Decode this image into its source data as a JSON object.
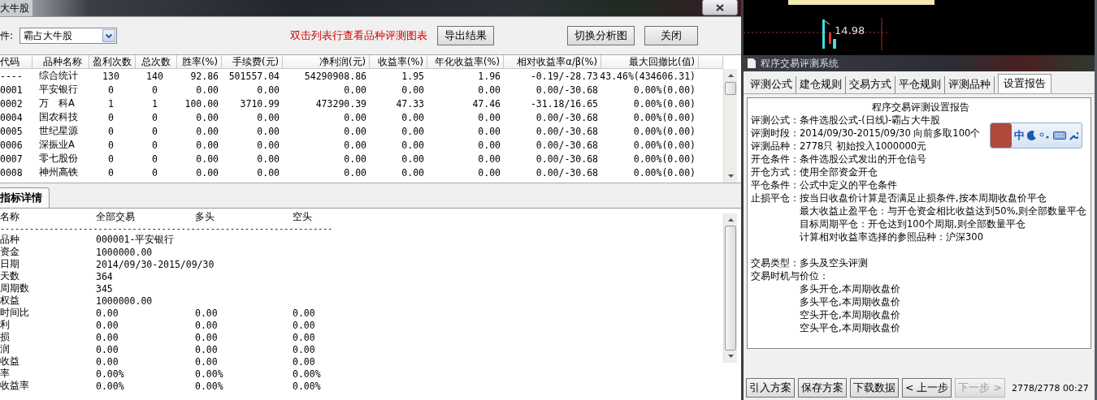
{
  "main_window": {
    "title": "大牛股",
    "condition": {
      "label": "件:",
      "value": "霸占大牛股"
    },
    "hint": "双击列表行查看品种评测图表",
    "export_button": "导出结果",
    "switch_button": "切换分析图",
    "close_button": "关闭",
    "table": {
      "columns": [
        "代码",
        "品种名称",
        "盈利次数",
        "总次数",
        "胜率(%)",
        "手续费(元)",
        "净利润(元)",
        "收益率(%)",
        "年化收益率(%)",
        "相对收益率α/β(%)",
        "最大回撤比(值)"
      ],
      "rows": [
        [
          "----",
          "综合统计",
          "130",
          "140",
          "92.86",
          "501557.04",
          "54290908.86",
          "1.95",
          "1.96",
          "-0.19/-28.73",
          "43.46%(434606.31)"
        ],
        [
          "0001",
          "平安银行",
          "0",
          "0",
          "0.00",
          "0.00",
          "0.00",
          "0.00",
          "0.00",
          "0.00/-30.68",
          "0.00%(0.00)"
        ],
        [
          "0002",
          "万　科A",
          "1",
          "1",
          "100.00",
          "3710.99",
          "473290.39",
          "47.33",
          "47.46",
          "-31.18/16.65",
          "0.00%(0.00)"
        ],
        [
          "0004",
          "国农科技",
          "0",
          "0",
          "0.00",
          "0.00",
          "0.00",
          "0.00",
          "0.00",
          "0.00/-30.68",
          "0.00%(0.00)"
        ],
        [
          "0005",
          "世纪星源",
          "0",
          "0",
          "0.00",
          "0.00",
          "0.00",
          "0.00",
          "0.00",
          "0.00/-30.68",
          "0.00%(0.00)"
        ],
        [
          "0006",
          "深振业A",
          "0",
          "0",
          "0.00",
          "0.00",
          "0.00",
          "0.00",
          "0.00",
          "0.00/-30.68",
          "0.00%(0.00)"
        ],
        [
          "0007",
          "零七股份",
          "0",
          "0",
          "0.00",
          "0.00",
          "0.00",
          "0.00",
          "0.00",
          "0.00/-30.68",
          "0.00%(0.00)"
        ],
        [
          "0008",
          "神州高铁",
          "0",
          "0",
          "0.00",
          "0.00",
          "0.00",
          "0.00",
          "0.00",
          "0.00/-30.68",
          "0.00%(0.00)"
        ]
      ]
    },
    "details": {
      "tabs": [
        {
          "label": "指标详情",
          "selected": true
        }
      ],
      "columns": [
        "名称",
        "全部交易",
        "多头",
        "空头"
      ],
      "separator": "--------------------------------------------------------------------",
      "rows": [
        [
          "品种",
          "000001-平安银行"
        ],
        [
          "资金",
          "1000000.00"
        ],
        [
          "日期",
          "2014/09/30-2015/09/30"
        ],
        [
          "天数",
          "364"
        ],
        [
          "周期数",
          "345"
        ],
        [
          "权益",
          "1000000.00"
        ],
        [
          "时间比",
          "0.00",
          "0.00",
          "0.00"
        ],
        [
          "利",
          "0.00",
          "0.00",
          "0.00"
        ],
        [
          "损",
          "0.00",
          "0.00",
          "0.00"
        ],
        [
          "润",
          "0.00",
          "0.00",
          "0.00"
        ],
        [
          "收益",
          "0.00",
          "0.00",
          "0.00"
        ],
        [
          "率",
          "0.00%",
          "0.00%",
          "0.00%"
        ],
        [
          "收益率",
          "0.00%",
          "0.00%",
          "0.00%"
        ]
      ]
    }
  },
  "chart_backdrop": {
    "price_label": "14.98"
  },
  "report_window": {
    "title": "程序交易评测系统",
    "tabs": [
      {
        "label": "评测公式",
        "selected": false
      },
      {
        "label": "建仓规则",
        "selected": false
      },
      {
        "label": "交易方式",
        "selected": false
      },
      {
        "label": "平仓规则",
        "selected": false
      },
      {
        "label": "评测品种",
        "selected": false
      },
      {
        "label": "设置报告",
        "selected": true
      }
    ],
    "heading": "程序交易评测设置报告",
    "sections": [
      [
        {
          "kind": "field",
          "label": "评测公式：",
          "text": "条件选股公式-(日线)-霸占大牛股"
        },
        {
          "kind": "field",
          "label": "评测时段：",
          "text": "2014/09/30-2015/09/30 向前多取100个"
        },
        {
          "kind": "field",
          "label": "评测品种：",
          "text": "2778只 初始投入1000000元"
        },
        {
          "kind": "field",
          "label": "开仓条件：",
          "text": "条件选股公式发出的开仓信号"
        },
        {
          "kind": "field",
          "label": "开仓方式：",
          "text": "使用全部资金开仓"
        },
        {
          "kind": "field",
          "label": "平仓条件：",
          "text": "公式中定义的平仓条件"
        },
        {
          "kind": "field",
          "label": "止损平仓：",
          "text": "按当日收盘价计算是否满足止损条件,按本周期收盘价平仓"
        },
        {
          "kind": "indent",
          "text": "最大收益止盈平仓：与开仓资金相比收益达到50%,则全部数量平仓"
        },
        {
          "kind": "indent",
          "text": "目标周期平仓：开仓达到100个周期,则全部数量平仓"
        },
        {
          "kind": "indent",
          "text": "计算相对收益率选择的参照品种：沪深300"
        }
      ],
      [
        {
          "kind": "field",
          "label": "交易类型：",
          "text": "多头及空头评测"
        },
        {
          "kind": "heading",
          "label": "交易时机与价位："
        },
        {
          "kind": "indent",
          "text": "多头开仓,本周期收盘价"
        },
        {
          "kind": "indent",
          "text": "多头平仓,本周期收盘价"
        },
        {
          "kind": "indent",
          "text": "空头开仓,本周期收盘价"
        },
        {
          "kind": "indent",
          "text": "空头平仓,本周期收盘价"
        }
      ]
    ],
    "ime_toolbar": {
      "mode": "中"
    },
    "buttons": [
      {
        "label": "引入方案",
        "disabled": false
      },
      {
        "label": "保存方案",
        "disabled": false
      },
      {
        "label": "下载数据",
        "disabled": false
      },
      {
        "label": "< 上一步",
        "disabled": false
      },
      {
        "label": "下一步 >",
        "disabled": true
      }
    ],
    "status": "2778/2778 00:27"
  }
}
